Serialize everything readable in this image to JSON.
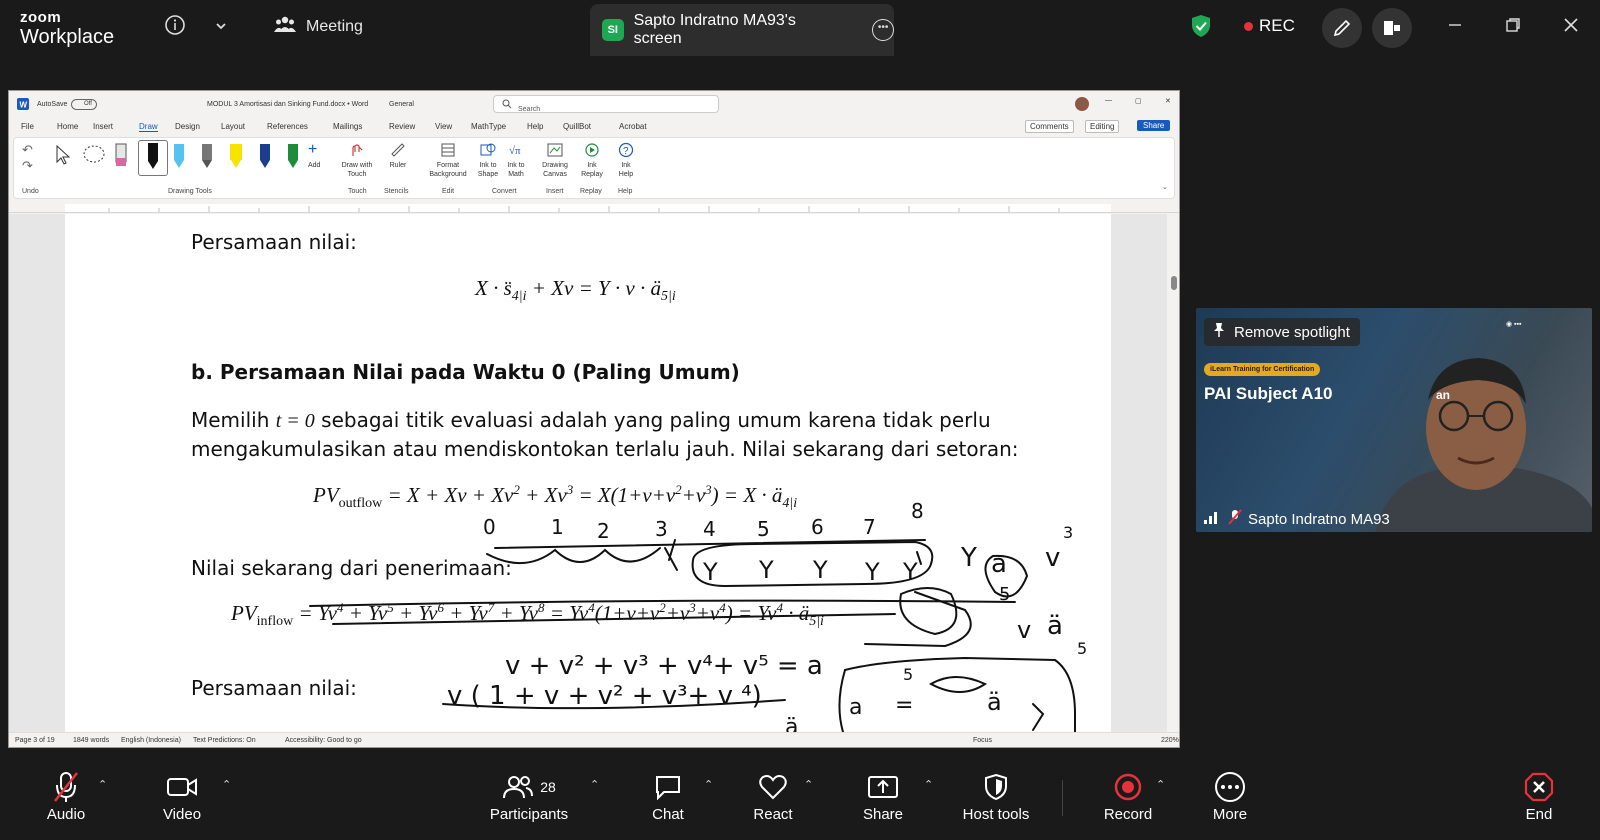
{
  "zoom": {
    "brand_line1": "zoom",
    "brand_line2": "Workplace",
    "meeting_label": "Meeting",
    "share_badge": "SI",
    "share_title": "Sapto Indratno MA93's screen",
    "rec_label": "REC",
    "colors": {
      "shield": "#1fa853",
      "rec": "#e6323a",
      "end": "#e6323a"
    }
  },
  "word": {
    "autosave": "AutoSave",
    "autosave_state": "Off",
    "doc_title": "MODUL 3 Amortisasi dan Sinking Fund.docx  •  Word",
    "sensitivity": "General",
    "search_placeholder": "Search",
    "menu": [
      "File",
      "Home",
      "Insert",
      "Draw",
      "Design",
      "Layout",
      "References",
      "Mailings",
      "Review",
      "View",
      "MathType",
      "Help",
      "QuillBot",
      "Acrobat"
    ],
    "active_menu": "Draw",
    "comments": "Comments",
    "editing": "Editing",
    "share": "Share",
    "ribbon": {
      "undo": "Undo",
      "drawing_tools": "Drawing Tools",
      "add": "Add",
      "draw_with_touch": "Draw with Touch",
      "touch": "Touch",
      "ruler": "Ruler",
      "stencils": "Stencils",
      "format_background": "Format Background",
      "edit": "Edit",
      "ink_to_shape": "Ink to Shape",
      "ink_to_math": "Ink to Math",
      "convert": "Convert",
      "drawing_canvas": "Drawing Canvas",
      "insert": "Insert",
      "ink_replay": "Ink Replay",
      "replay": "Replay",
      "ink_help": "Ink Help",
      "help": "Help"
    },
    "status": {
      "page": "Page 3 of 19",
      "words": "1849 words",
      "language": "English (Indonesia)",
      "predictions": "Text Predictions: On",
      "accessibility": "Accessibility: Good to go",
      "focus": "Focus",
      "zoom": "220%"
    }
  },
  "document": {
    "line1": "Persamaan nilai:",
    "heading_b": "b. Persamaan Nilai pada Waktu 0 (Paling Umum)",
    "para1_pre": "Memilih",
    "para1_post": "sebagai  titik  evaluasi  adalah  yang  paling  umum  karena  tidak  perlu",
    "para2": "mengakumulasikan atau mendiskontokan terlalu jauh. Nilai sekarang dari setoran:",
    "line_receive": "Nilai sekarang dari penerimaan:",
    "line_last": "Persamaan nilai:"
  },
  "spotlight": {
    "remove_spotlight": "Remove spotlight",
    "badge": "iLearn Training for Certification",
    "subject": "PAI Subject A10",
    "subject_suffix": "an",
    "participant_name": "Sapto Indratno MA93"
  },
  "toolbar": {
    "audio": "Audio",
    "video": "Video",
    "participants": "Participants",
    "participants_count": "28",
    "chat": "Chat",
    "react": "React",
    "share": "Share",
    "host_tools": "Host tools",
    "record": "Record",
    "more": "More",
    "end": "End"
  }
}
